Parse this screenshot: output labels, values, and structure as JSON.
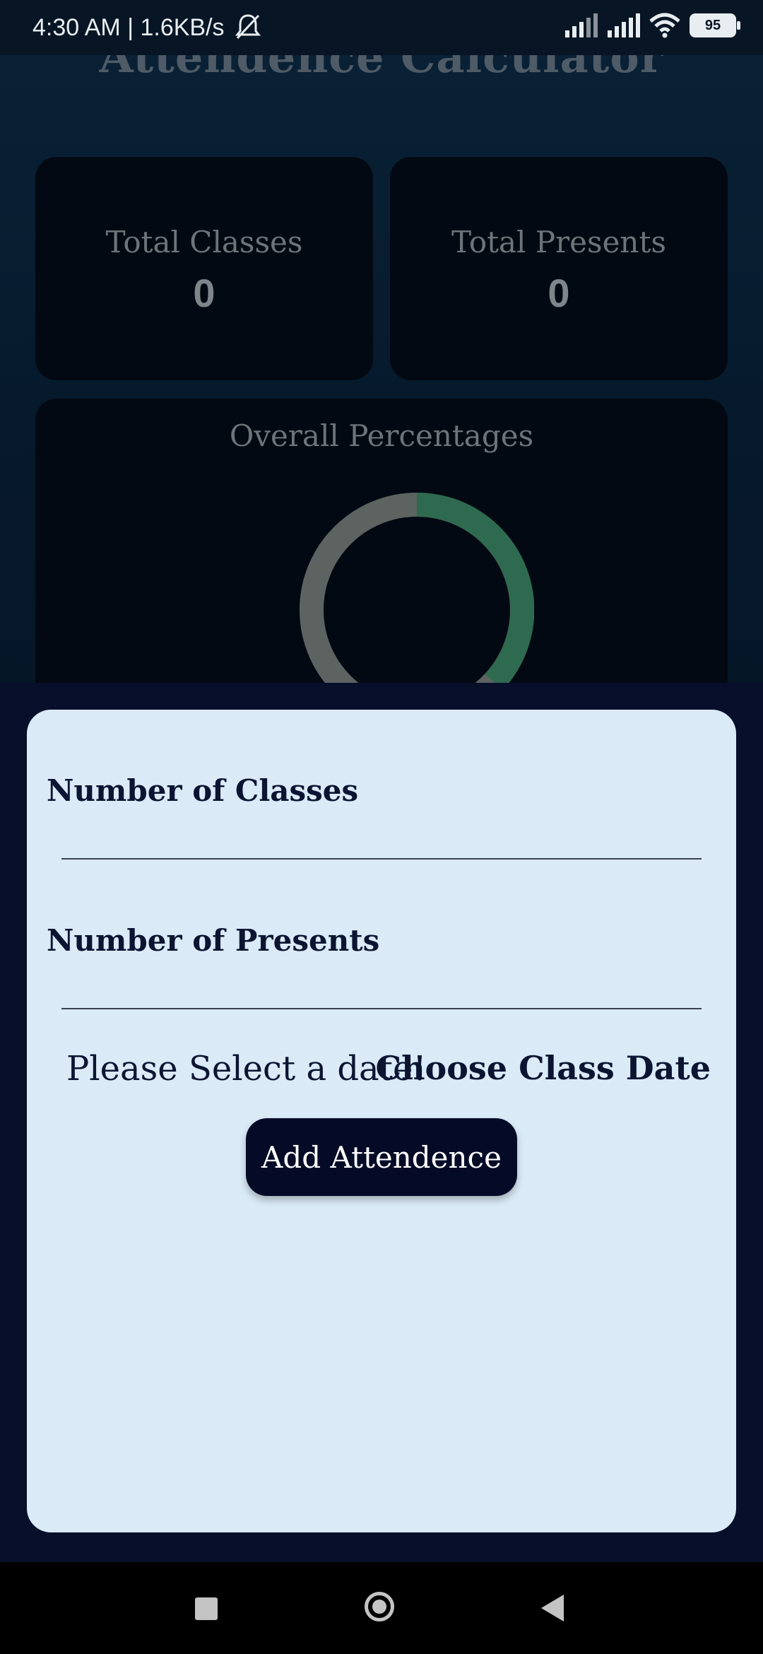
{
  "status_bar": {
    "time_speed": "4:30 AM | 1.6KB/s",
    "battery": "95"
  },
  "app": {
    "title": "Attendence Calculator",
    "total_classes": {
      "label": "Total Classes",
      "value": "0"
    },
    "total_presents": {
      "label": "Total Presents",
      "value": "0"
    },
    "overall": {
      "label": "Overall Percentages"
    }
  },
  "sheet": {
    "classes_label": "Number of Classes",
    "classes_value": "",
    "presents_label": "Number of Presents",
    "presents_value": "",
    "date_message": "Please Select a date!",
    "choose_date_label": "Choose Class Date",
    "add_button_label": "Add Attendence"
  },
  "colors": {
    "sheet_bg": "#daeaf7",
    "button_bg": "#050b27",
    "ring_present": "#2e6a4f",
    "ring_absent": "#5c6360"
  }
}
